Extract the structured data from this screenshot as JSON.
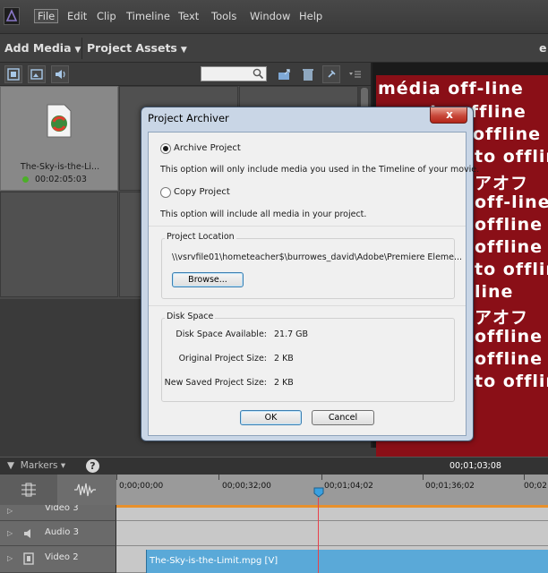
{
  "menu": {
    "items": [
      "File",
      "Edit",
      "Clip",
      "Timeline",
      "Text",
      "Tools",
      "Window",
      "Help"
    ]
  },
  "panels": {
    "add_media": "Add Media",
    "project_assets": "Project Assets",
    "extra_label": "e"
  },
  "assets": {
    "search_placeholder": "",
    "items": [
      {
        "name": "The-Sky-is-the-Li...",
        "duration": "00:02:05:03",
        "status_color": "#4caf28"
      }
    ]
  },
  "monitor": {
    "lines": [
      "média off-line",
      "to offline",
      "offline",
      "to offlin",
      "アオフ",
      "off-line",
      "offline",
      "offline",
      "to offlin",
      "line",
      "アオフ",
      "offline",
      "offline",
      "to offlin"
    ]
  },
  "dialog": {
    "title": "Project Archiver",
    "close_label": "x",
    "archive_label": "Archive Project",
    "archive_desc": "This option will only include media you used in the Timeline of your movie.",
    "copy_label": "Copy Project",
    "copy_desc": "This option will include all media in your project.",
    "location_title": "Project Location",
    "location_path": "\\\\vsrvfile01\\hometeacher$\\burrowes_david\\Adobe\\Premiere Eleme...",
    "browse_label": "Browse...",
    "disk_title": "Disk Space",
    "disk_available_label": "Disk Space Available:",
    "disk_available_value": "21.7 GB",
    "original_size_label": "Original Project Size:",
    "original_size_value": "2 KB",
    "new_size_label": "New Saved Project Size:",
    "new_size_value": "2 KB",
    "ok_label": "OK",
    "cancel_label": "Cancel",
    "selected_option": "archive"
  },
  "timeline": {
    "markers_label": "Markers",
    "help_label": "?",
    "current_timecode": "00;01;03;08",
    "ruler_labels": [
      "0;00;00;00",
      "00;00;32;00",
      "00;01;04;02",
      "00;01;36;02",
      "00;02"
    ],
    "tracks": [
      {
        "name": "Video 3"
      },
      {
        "name": "Audio 3"
      },
      {
        "name": "Video 2"
      }
    ],
    "clip_label": "The-Sky-is-the-Limit.mpg [V]"
  },
  "colors": {
    "accent": "#5aa9d8",
    "playhead": "#e8404a",
    "offline_bg": "#8a0f17"
  }
}
